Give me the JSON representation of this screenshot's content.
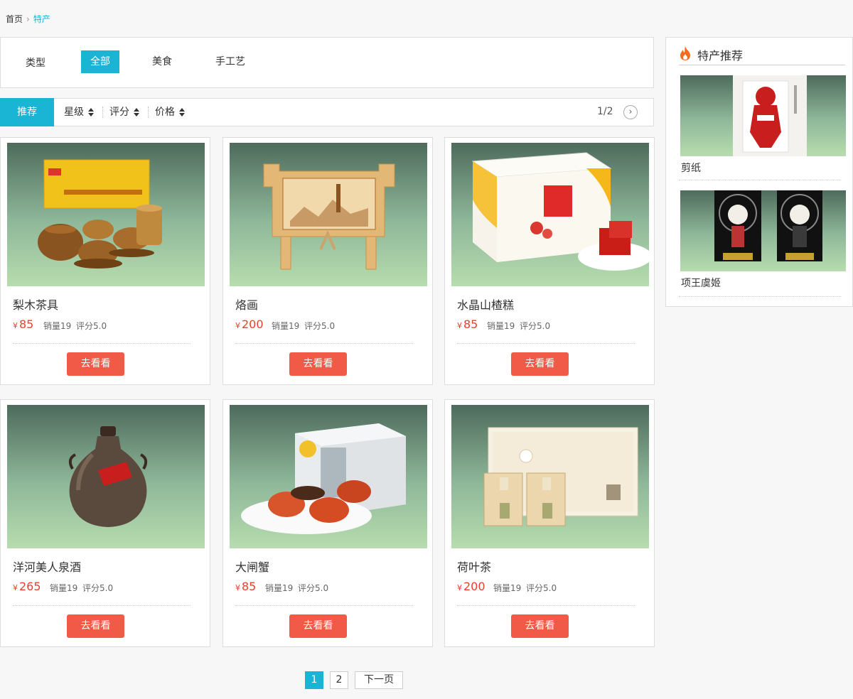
{
  "breadcrumb": {
    "home": "首页",
    "separator": "›",
    "current": "特产"
  },
  "filter": {
    "label": "类型",
    "options": [
      "全部",
      "美食",
      "手工艺"
    ],
    "active_index": 0
  },
  "sort": {
    "recommend": "推荐",
    "options": [
      "星级",
      "评分",
      "价格"
    ],
    "page_indicator": "1/2",
    "next_icon": "›"
  },
  "products": [
    {
      "name": "梨木茶具",
      "currency": "¥",
      "price": "85",
      "sales": "销量19",
      "rating": "评分5.0",
      "button": "去看看"
    },
    {
      "name": "烙画",
      "currency": "¥",
      "price": "200",
      "sales": "销量19",
      "rating": "评分5.0",
      "button": "去看看"
    },
    {
      "name": "水晶山楂糕",
      "currency": "¥",
      "price": "85",
      "sales": "销量19",
      "rating": "评分5.0",
      "button": "去看看"
    },
    {
      "name": "洋河美人泉酒",
      "currency": "¥",
      "price": "265",
      "sales": "销量19",
      "rating": "评分5.0",
      "button": "去看看"
    },
    {
      "name": "大闸蟹",
      "currency": "¥",
      "price": "85",
      "sales": "销量19",
      "rating": "评分5.0",
      "button": "去看看"
    },
    {
      "name": "荷叶茶",
      "currency": "¥",
      "price": "200",
      "sales": "销量19",
      "rating": "评分5.0",
      "button": "去看看"
    }
  ],
  "sidebar": {
    "title": "特产推荐",
    "items": [
      {
        "label": "剪纸"
      },
      {
        "label": "项王虞姬"
      }
    ]
  },
  "pagination": {
    "pages": [
      "1",
      "2"
    ],
    "active": "1",
    "next": "下一页"
  },
  "colors": {
    "accent": "#1ab4d4",
    "price": "#e8402c",
    "button": "#f25a48"
  },
  "icons": {
    "fire": "fire-icon",
    "breadcrumb_separator": "chevron-right-icon",
    "next_page": "chevron-right-circle-icon",
    "sort": "sort-arrows-icon"
  }
}
